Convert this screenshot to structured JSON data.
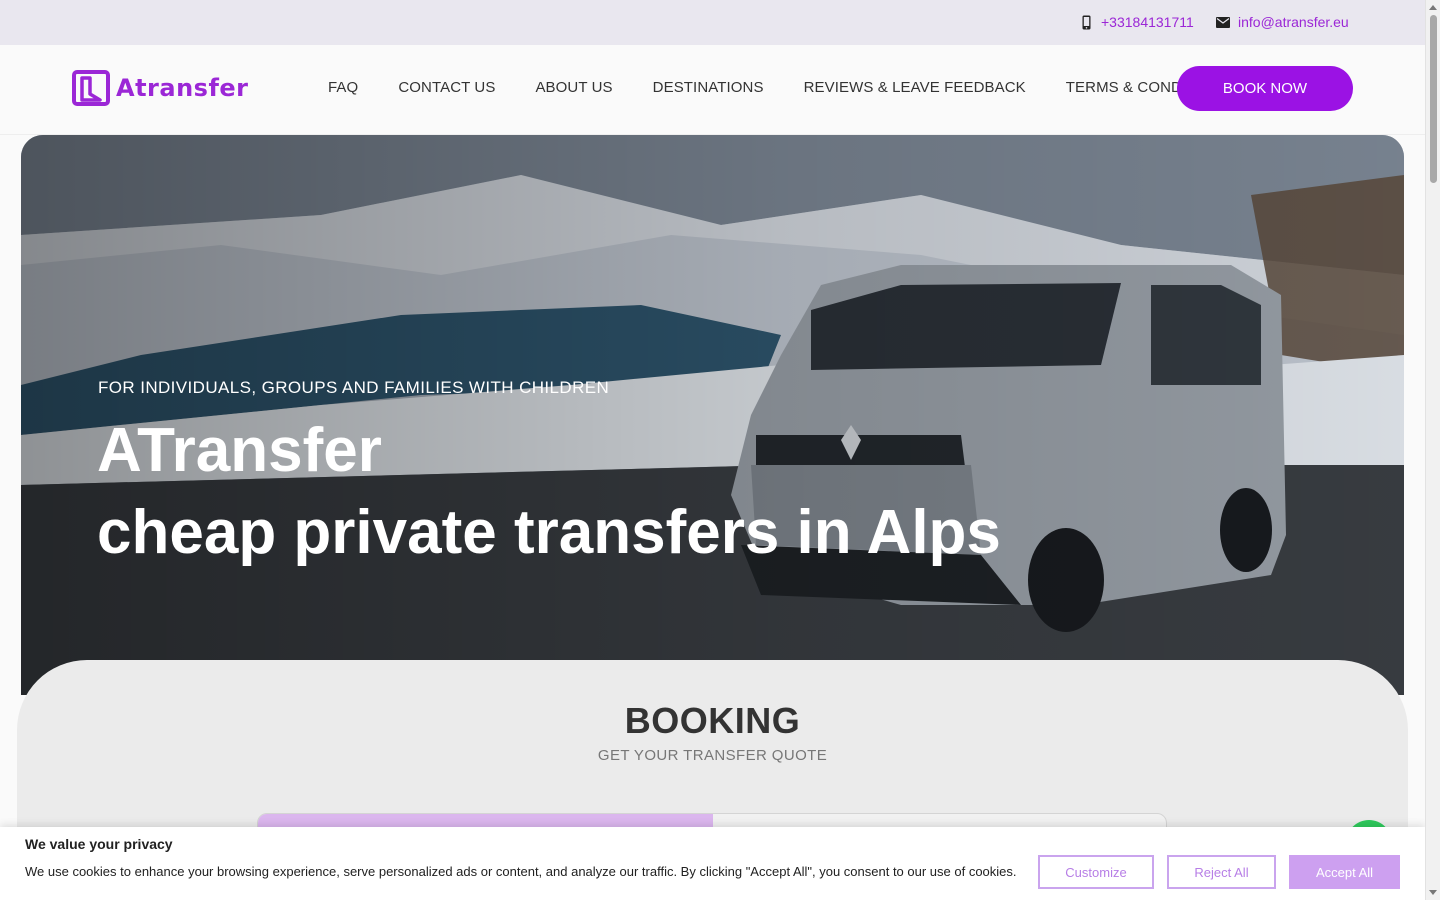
{
  "topbar": {
    "phone": "+33184131711",
    "email": "info@atransfer.eu",
    "phone_icon": "mobile-phone-icon",
    "email_icon": "envelope-icon"
  },
  "header": {
    "logo_text": "Atransfer",
    "nav": [
      "FAQ",
      "CONTACT US",
      "ABOUT US",
      "DESTINATIONS",
      "REVIEWS & LEAVE FEEDBACK",
      "TERMS & CONDITIONS"
    ],
    "cta": "BOOK NOW"
  },
  "hero": {
    "tagline": "FOR INDIVIDUALS, GROUPS AND FAMILIES WITH CHILDREN",
    "title_line1": "ATransfer",
    "title_line2": "cheap private transfers in Alps"
  },
  "booking": {
    "title": "BOOKING",
    "subtitle": "GET YOUR TRANSFER QUOTE"
  },
  "cookie": {
    "title": "We value your privacy",
    "text": "We use cookies to enhance your browsing experience, serve personalized ads or content, and analyze our traffic. By clicking \"Accept All\", you consent to our use of cookies.",
    "customize": "Customize",
    "reject": "Reject All",
    "accept": "Accept All"
  },
  "colors": {
    "brand": "#9b12e4",
    "brand_text": "#9b27d6",
    "chat": "#2ec95c"
  }
}
